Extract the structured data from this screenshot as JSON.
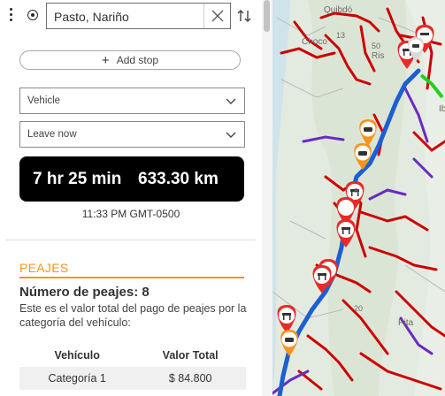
{
  "route": {
    "origin": "Pasto, Nariño",
    "add_stop_label": "Add stop",
    "vehicle_select": "Vehicle",
    "time_select": "Leave now"
  },
  "summary": {
    "duration": "7 hr 25 min",
    "distance": "633.30 km",
    "arrival": "11:33 PM GMT-0500"
  },
  "tolls": {
    "title": "PEAJES",
    "count_label": "Número de peajes: 8",
    "description": "Este es el valor total del pago de peajes por la categoría del vehículo:",
    "columns": [
      "Vehículo",
      "Valor Total"
    ],
    "rows": [
      [
        "Categoría 1",
        "$ 84.800"
      ]
    ]
  },
  "map": {
    "labels": {
      "quibdo": "Quibdó",
      "choco": "Choco",
      "road_13": "13",
      "road_50": "50",
      "road_20": "20",
      "ris": "Ris",
      "ib": "Ib",
      "a": "a",
      "pita": "Pita"
    },
    "colors": {
      "route": "#1d5fd1",
      "red_roads": "#cc0000",
      "purple_roads": "#6a2bbf",
      "toll_red": "#e82a2a",
      "toll_orange": "#f7941d",
      "destination": "#1fd11f"
    },
    "toll_markers_count": 12
  }
}
